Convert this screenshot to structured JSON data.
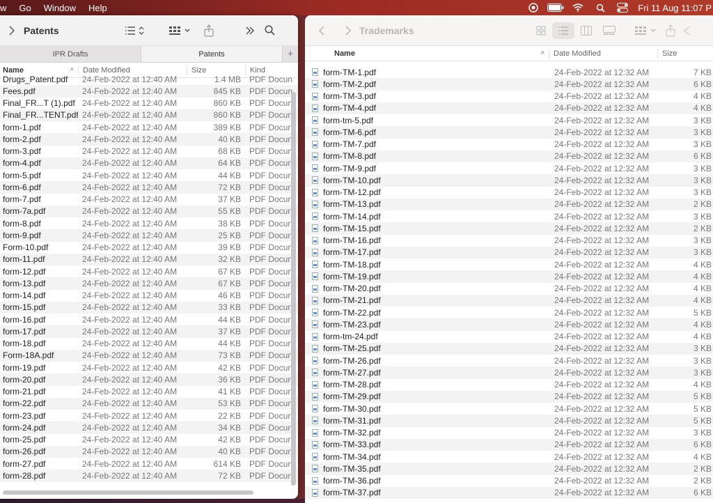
{
  "menubar": {
    "items": [
      "w",
      "Go",
      "Window",
      "Help"
    ],
    "clock": "Fri 11 Aug  11:07 P",
    "status_icons": [
      "screen-record-icon",
      "battery-icon",
      "wifi-icon",
      "spotlight-icon",
      "control-center-icon"
    ]
  },
  "left_window": {
    "title": "Patents",
    "tabs": [
      "IPR Drafts",
      "Patents"
    ],
    "columns": {
      "name": "Name",
      "date": "Date Modified",
      "size": "Size",
      "kind": "Kind"
    },
    "files": [
      {
        "name": "Drugs_Patent.pdf",
        "date": "24-Feb-2022 at 12:40 AM",
        "size": "1.4 MB",
        "kind": "PDF Docun"
      },
      {
        "name": "Fees.pdf",
        "date": "24-Feb-2022 at 12:40 AM",
        "size": "845 KB",
        "kind": "PDF Docun"
      },
      {
        "name": "Final_FR...T (1).pdf",
        "date": "24-Feb-2022 at 12:40 AM",
        "size": "860 KB",
        "kind": "PDF Docun"
      },
      {
        "name": "Final_FR...TENT.pdf",
        "date": "24-Feb-2022 at 12:40 AM",
        "size": "860 KB",
        "kind": "PDF Docun"
      },
      {
        "name": "form-1.pdf",
        "date": "24-Feb-2022 at 12:40 AM",
        "size": "389 KB",
        "kind": "PDF Docun"
      },
      {
        "name": "form-2.pdf",
        "date": "24-Feb-2022 at 12:40 AM",
        "size": "40 KB",
        "kind": "PDF Docun"
      },
      {
        "name": "form-3.pdf",
        "date": "24-Feb-2022 at 12:40 AM",
        "size": "68 KB",
        "kind": "PDF Docun"
      },
      {
        "name": "form-4.pdf",
        "date": "24-Feb-2022 at 12:40 AM",
        "size": "64 KB",
        "kind": "PDF Docun"
      },
      {
        "name": "form-5.pdf",
        "date": "24-Feb-2022 at 12:40 AM",
        "size": "44 KB",
        "kind": "PDF Docun"
      },
      {
        "name": "form-6.pdf",
        "date": "24-Feb-2022 at 12:40 AM",
        "size": "72 KB",
        "kind": "PDF Docun"
      },
      {
        "name": "form-7.pdf",
        "date": "24-Feb-2022 at 12:40 AM",
        "size": "37 KB",
        "kind": "PDF Docun"
      },
      {
        "name": "form-7a.pdf",
        "date": "24-Feb-2022 at 12:40 AM",
        "size": "55 KB",
        "kind": "PDF Docun"
      },
      {
        "name": "form-8.pdf",
        "date": "24-Feb-2022 at 12:40 AM",
        "size": "38 KB",
        "kind": "PDF Docun"
      },
      {
        "name": "form-9.pdf",
        "date": "24-Feb-2022 at 12:40 AM",
        "size": "25 KB",
        "kind": "PDF Docun"
      },
      {
        "name": "Form-10.pdf",
        "date": "24-Feb-2022 at 12:40 AM",
        "size": "39 KB",
        "kind": "PDF Docun"
      },
      {
        "name": "form-11.pdf",
        "date": "24-Feb-2022 at 12:40 AM",
        "size": "32 KB",
        "kind": "PDF Docun"
      },
      {
        "name": "form-12.pdf",
        "date": "24-Feb-2022 at 12:40 AM",
        "size": "67 KB",
        "kind": "PDF Docun"
      },
      {
        "name": "form-13.pdf",
        "date": "24-Feb-2022 at 12:40 AM",
        "size": "67 KB",
        "kind": "PDF Docun"
      },
      {
        "name": "form-14.pdf",
        "date": "24-Feb-2022 at 12:40 AM",
        "size": "46 KB",
        "kind": "PDF Docun"
      },
      {
        "name": "form-15.pdf",
        "date": "24-Feb-2022 at 12:40 AM",
        "size": "33 KB",
        "kind": "PDF Docun"
      },
      {
        "name": "form-16.pdf",
        "date": "24-Feb-2022 at 12:40 AM",
        "size": "44 KB",
        "kind": "PDF Docun"
      },
      {
        "name": "form-17.pdf",
        "date": "24-Feb-2022 at 12:40 AM",
        "size": "37 KB",
        "kind": "PDF Docun"
      },
      {
        "name": "form-18.pdf",
        "date": "24-Feb-2022 at 12:40 AM",
        "size": "44 KB",
        "kind": "PDF Docun"
      },
      {
        "name": "Form-18A.pdf",
        "date": "24-Feb-2022 at 12:40 AM",
        "size": "73 KB",
        "kind": "PDF Docun"
      },
      {
        "name": "form-19.pdf",
        "date": "24-Feb-2022 at 12:40 AM",
        "size": "42 KB",
        "kind": "PDF Docun"
      },
      {
        "name": "form-20.pdf",
        "date": "24-Feb-2022 at 12:40 AM",
        "size": "36 KB",
        "kind": "PDF Docun"
      },
      {
        "name": "form-21.pdf",
        "date": "24-Feb-2022 at 12:40 AM",
        "size": "41 KB",
        "kind": "PDF Docun"
      },
      {
        "name": "form-22.pdf",
        "date": "24-Feb-2022 at 12:40 AM",
        "size": "53 KB",
        "kind": "PDF Docun"
      },
      {
        "name": "form-23.pdf",
        "date": "24-Feb-2022 at 12:40 AM",
        "size": "22 KB",
        "kind": "PDF Docun"
      },
      {
        "name": "form-24.pdf",
        "date": "24-Feb-2022 at 12:40 AM",
        "size": "34 KB",
        "kind": "PDF Docun"
      },
      {
        "name": "form-25.pdf",
        "date": "24-Feb-2022 at 12:40 AM",
        "size": "42 KB",
        "kind": "PDF Docun"
      },
      {
        "name": "form-26.pdf",
        "date": "24-Feb-2022 at 12:40 AM",
        "size": "40 KB",
        "kind": "PDF Docun"
      },
      {
        "name": "form-27.pdf",
        "date": "24-Feb-2022 at 12:40 AM",
        "size": "614 KB",
        "kind": "PDF Docun"
      },
      {
        "name": "form-28.pdf",
        "date": "24-Feb-2022 at 12:40 AM",
        "size": "72 KB",
        "kind": "PDF Docun"
      }
    ]
  },
  "right_window": {
    "title": "Trademarks",
    "columns": {
      "name": "Name",
      "date": "Date Modified",
      "size": "Size"
    },
    "files": [
      {
        "name": "form-TM-1.pdf",
        "date": "24-Feb-2022 at 12:32 AM",
        "size": "7 KB"
      },
      {
        "name": "form-TM-2.pdf",
        "date": "24-Feb-2022 at 12:32 AM",
        "size": "6 KB"
      },
      {
        "name": "form-TM-3.pdf",
        "date": "24-Feb-2022 at 12:32 AM",
        "size": "4 KB"
      },
      {
        "name": "form-TM-4.pdf",
        "date": "24-Feb-2022 at 12:32 AM",
        "size": "4 KB"
      },
      {
        "name": "form-tm-5.pdf",
        "date": "24-Feb-2022 at 12:32 AM",
        "size": "3 KB"
      },
      {
        "name": "form-TM-6.pdf",
        "date": "24-Feb-2022 at 12:32 AM",
        "size": "3 KB"
      },
      {
        "name": "form-TM-7.pdf",
        "date": "24-Feb-2022 at 12:32 AM",
        "size": "3 KB"
      },
      {
        "name": "form-TM-8.pdf",
        "date": "24-Feb-2022 at 12:32 AM",
        "size": "6 KB"
      },
      {
        "name": "form-TM-9.pdf",
        "date": "24-Feb-2022 at 12:32 AM",
        "size": "3 KB"
      },
      {
        "name": "form-TM-10.pdf",
        "date": "24-Feb-2022 at 12:32 AM",
        "size": "3 KB"
      },
      {
        "name": "form-TM-12.pdf",
        "date": "24-Feb-2022 at 12:32 AM",
        "size": "3 KB"
      },
      {
        "name": "form-TM-13.pdf",
        "date": "24-Feb-2022 at 12:32 AM",
        "size": "2 KB"
      },
      {
        "name": "form-TM-14.pdf",
        "date": "24-Feb-2022 at 12:32 AM",
        "size": "3 KB"
      },
      {
        "name": "form-TM-15.pdf",
        "date": "24-Feb-2022 at 12:32 AM",
        "size": "2 KB"
      },
      {
        "name": "form-TM-16.pdf",
        "date": "24-Feb-2022 at 12:32 AM",
        "size": "3 KB"
      },
      {
        "name": "form-TM-17.pdf",
        "date": "24-Feb-2022 at 12:32 AM",
        "size": "3 KB"
      },
      {
        "name": "form-TM-18.pdf",
        "date": "24-Feb-2022 at 12:32 AM",
        "size": "4 KB"
      },
      {
        "name": "form-TM-19.pdf",
        "date": "24-Feb-2022 at 12:32 AM",
        "size": "4 KB"
      },
      {
        "name": "form-TM-20.pdf",
        "date": "24-Feb-2022 at 12:32 AM",
        "size": "4 KB"
      },
      {
        "name": "form-TM-21.pdf",
        "date": "24-Feb-2022 at 12:32 AM",
        "size": "4 KB"
      },
      {
        "name": "form-TM-22.pdf",
        "date": "24-Feb-2022 at 12:32 AM",
        "size": "5 KB"
      },
      {
        "name": "form-TM-23.pdf",
        "date": "24-Feb-2022 at 12:32 AM",
        "size": "4 KB"
      },
      {
        "name": "form-tm-24.pdf",
        "date": "24-Feb-2022 at 12:32 AM",
        "size": "4 KB"
      },
      {
        "name": "form-TM-25.pdf",
        "date": "24-Feb-2022 at 12:32 AM",
        "size": "3 KB"
      },
      {
        "name": "form-TM-26.pdf",
        "date": "24-Feb-2022 at 12:32 AM",
        "size": "3 KB"
      },
      {
        "name": "form-TM-27.pdf",
        "date": "24-Feb-2022 at 12:32 AM",
        "size": "3 KB"
      },
      {
        "name": "form-TM-28.pdf",
        "date": "24-Feb-2022 at 12:32 AM",
        "size": "4 KB"
      },
      {
        "name": "form-TM-29.pdf",
        "date": "24-Feb-2022 at 12:32 AM",
        "size": "5 KB"
      },
      {
        "name": "form-TM-30.pdf",
        "date": "24-Feb-2022 at 12:32 AM",
        "size": "5 KB"
      },
      {
        "name": "form-TM-31.pdf",
        "date": "24-Feb-2022 at 12:32 AM",
        "size": "5 KB"
      },
      {
        "name": "form-TM-32.pdf",
        "date": "24-Feb-2022 at 12:32 AM",
        "size": "3 KB"
      },
      {
        "name": "form-TM-33.pdf",
        "date": "24-Feb-2022 at 12:32 AM",
        "size": "6 KB"
      },
      {
        "name": "form-TM-34.pdf",
        "date": "24-Feb-2022 at 12:32 AM",
        "size": "4 KB"
      },
      {
        "name": "form-TM-35.pdf",
        "date": "24-Feb-2022 at 12:32 AM",
        "size": "2 KB"
      },
      {
        "name": "form-TM-36.pdf",
        "date": "24-Feb-2022 at 12:32 AM",
        "size": "2 KB"
      },
      {
        "name": "form-TM-37.pdf",
        "date": "24-Feb-2022 at 12:32 AM",
        "size": "6 KB"
      }
    ]
  }
}
